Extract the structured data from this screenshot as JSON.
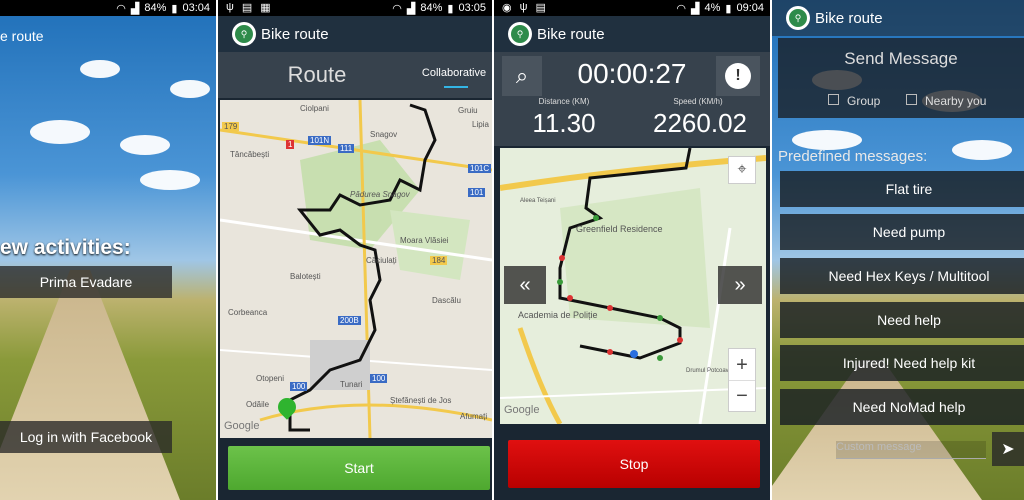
{
  "screen1": {
    "app_title": "e route",
    "heading": "ew activities:",
    "activity_button": "Prima Evadare",
    "facebook_button": "Log in with Facebook"
  },
  "screen2": {
    "status": {
      "battery": "84%",
      "time": "03:05"
    },
    "app_title": "Bike route",
    "tab_route": "Route",
    "tab_collaborative": "Collaborative",
    "start_button": "Start",
    "map_labels": [
      "Ciolpani",
      "Gruiu",
      "Lipia",
      "Snagov",
      "Tâncăbești",
      "Pădurea Snagov",
      "Moara Vlăsiei",
      "Căciulați",
      "Balotești",
      "Dascălu",
      "Corbeanca",
      "Otopeni",
      "Tunari",
      "Ștefănești de Jos",
      "Odăile",
      "Afumați",
      "Google"
    ],
    "road_labels": [
      "179",
      "101N",
      "111",
      "101C",
      "101",
      "1",
      "184",
      "200B",
      "100",
      "100"
    ]
  },
  "screen1_status": {
    "battery": "84%",
    "time": "03:04"
  },
  "screen3": {
    "status": {
      "battery": "4%",
      "time": "09:04"
    },
    "app_title": "Bike route",
    "timer": "00:00:27",
    "distance_label": "Distance (KM)",
    "distance_value": "11.30",
    "speed_label": "Speed (KM/h)",
    "speed_value": "2260.02",
    "prev_button": "«",
    "next_button": "»",
    "zoom_in": "+",
    "zoom_out": "−",
    "stop_button": "Stop",
    "map_labels": [
      "Greenfield Residence",
      "Academia de Poliție",
      "Google",
      "Aleea Teișani",
      "Drumul Potcoavei"
    ]
  },
  "screen4": {
    "app_title": "Bike route",
    "title": "Send Message",
    "group_label": "Group",
    "nearby_label": "Nearby you",
    "predefined_label": "Predefined messages:",
    "messages": [
      "Flat tire",
      "Need pump",
      "Need Hex Keys / Multitool",
      "Need help",
      "Injured! Need help kit",
      "Need NoMad help"
    ],
    "custom_placeholder": "Custom message"
  },
  "colors": {
    "accent_green": "#4ea82f",
    "stop_red": "#d00000",
    "tab_indicator": "#33b5e5",
    "appbar_dark": "#1c2a3a"
  },
  "icons": [
    "wifi-icon",
    "signal-icon",
    "battery-icon",
    "bike-logo-icon",
    "zoom-icon",
    "alert-icon",
    "location-icon",
    "send-icon",
    "map-pin-icon"
  ]
}
